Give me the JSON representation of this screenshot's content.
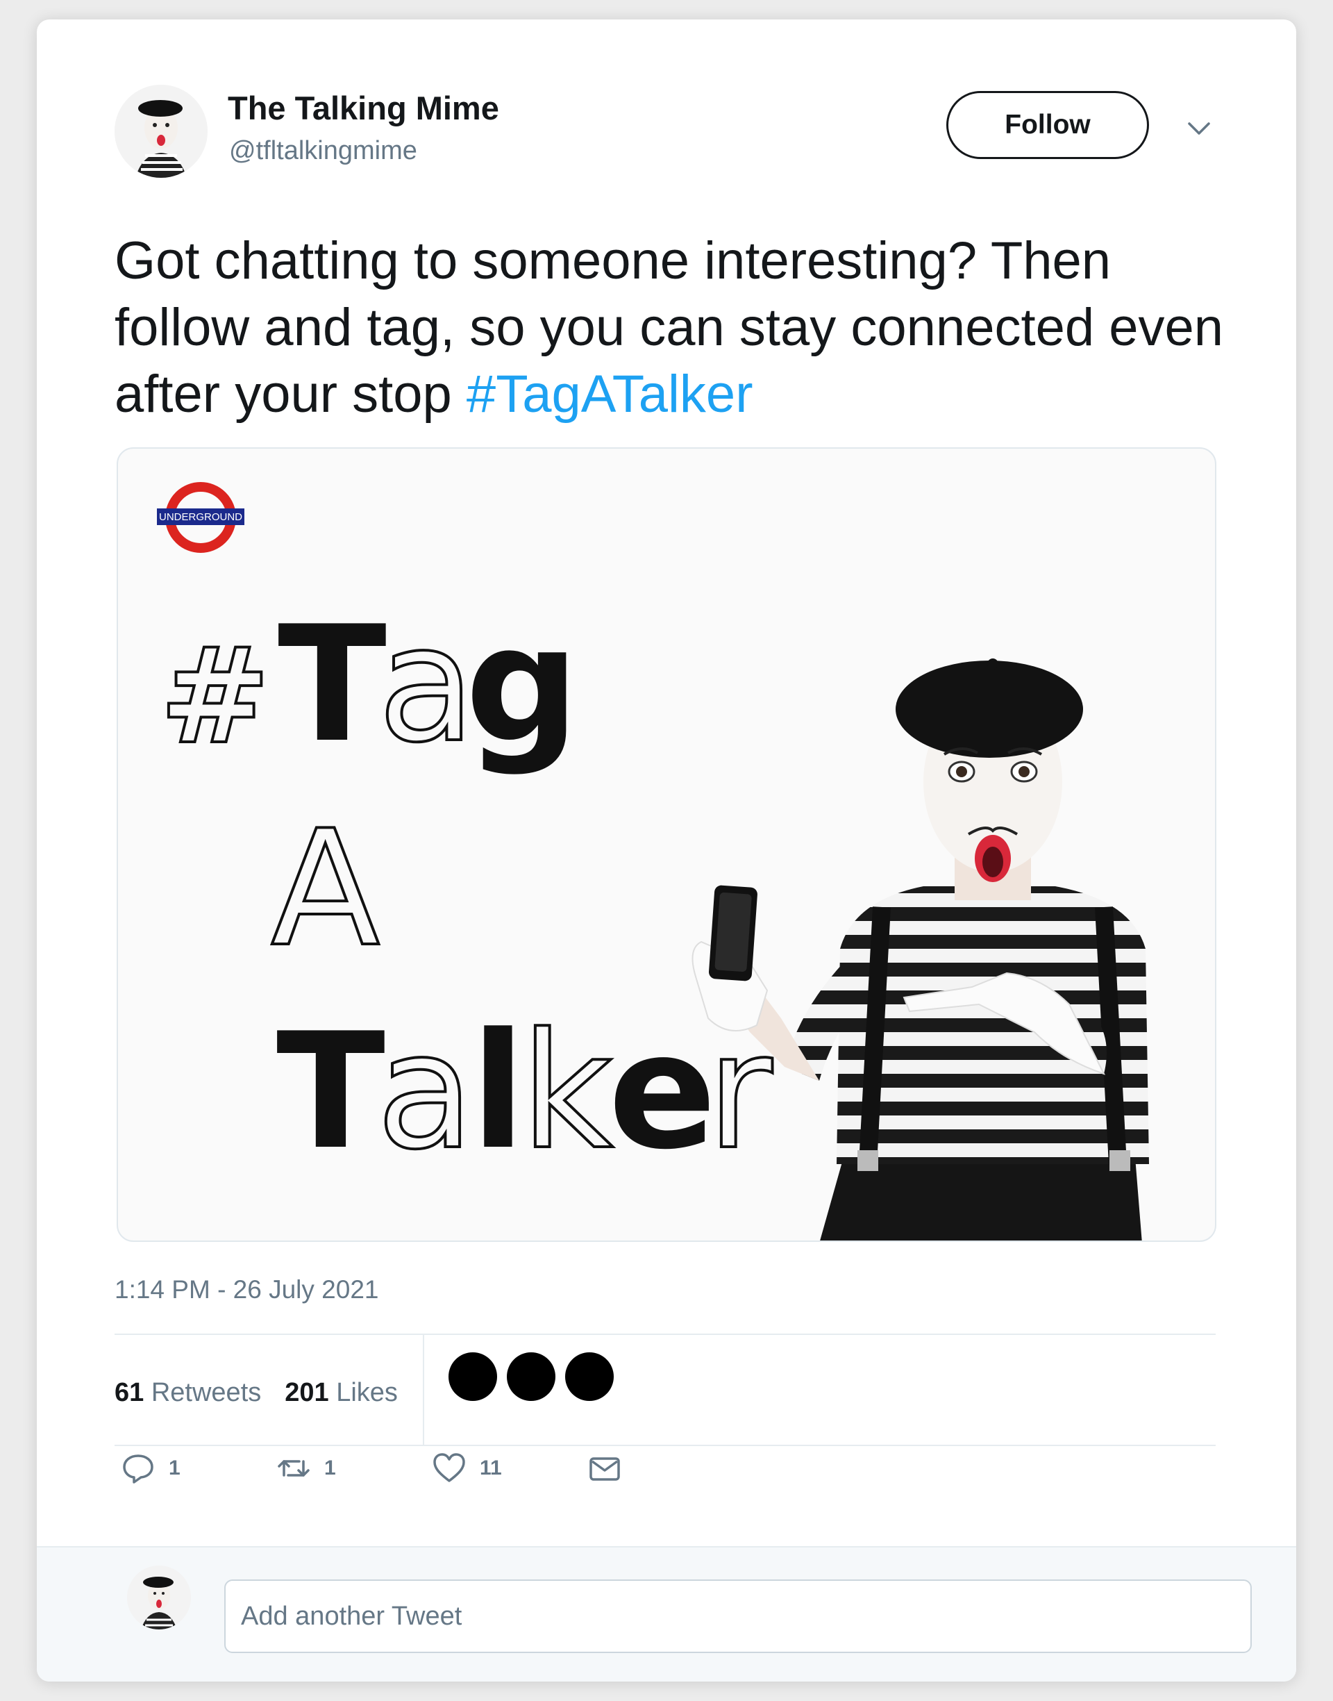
{
  "author": {
    "name": "The Talking Mime",
    "handle": "@tfltalkingmime",
    "follow_label": "Follow"
  },
  "tweet": {
    "text": "Got chatting to someone interesting? Then follow and tag, so you can stay connected even after your stop ",
    "hashtag": "#TagATalker",
    "timestamp": "1:14 PM - 26 July 2021"
  },
  "media": {
    "logo_text": "UNDERGROUND",
    "hash": "#",
    "tag_T": "T",
    "tag_a": "a",
    "tag_g": "g",
    "line2": "A",
    "talker_T": "T",
    "talker_a": "a",
    "talker_l": "l",
    "talker_k": "k",
    "talker_e": "e",
    "talker_r": "r"
  },
  "stats": {
    "retweets_count": "61",
    "retweets_label": "Retweets",
    "likes_count": "201",
    "likes_label": "Likes"
  },
  "actions": {
    "reply_count": "1",
    "retweet_count": "1",
    "like_count": "11"
  },
  "reply": {
    "placeholder": "Add another Tweet"
  },
  "colors": {
    "hashtag": "#1da1f2",
    "underground_red": "#dc241f",
    "underground_blue": "#1b2a8c",
    "secondary_text": "#657786"
  }
}
